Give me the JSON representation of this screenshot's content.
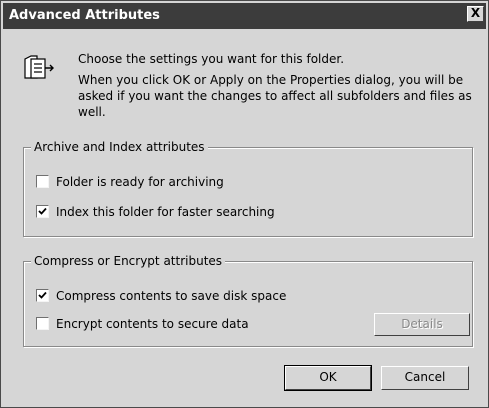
{
  "window": {
    "title": "Advanced Attributes",
    "close_glyph": "X"
  },
  "intro": {
    "icon": "folder-settings-icon",
    "heading": "Choose the settings you want for this folder.",
    "description": "When you click OK or Apply on the Properties dialog, you will be asked if you want the changes to affect all subfolders and files as well."
  },
  "archive_group": {
    "legend": "Archive and Index attributes",
    "ready_for_archiving": {
      "label": "Folder is ready for archiving",
      "checked": false
    },
    "index_faster": {
      "label": "Index this folder for faster searching",
      "checked": true
    }
  },
  "compress_group": {
    "legend": "Compress or Encrypt attributes",
    "compress": {
      "label": "Compress contents to save disk space",
      "checked": true
    },
    "encrypt": {
      "label": "Encrypt contents to secure data",
      "checked": false
    },
    "details_label": "Details",
    "details_enabled": false
  },
  "buttons": {
    "ok": "OK",
    "cancel": "Cancel"
  }
}
